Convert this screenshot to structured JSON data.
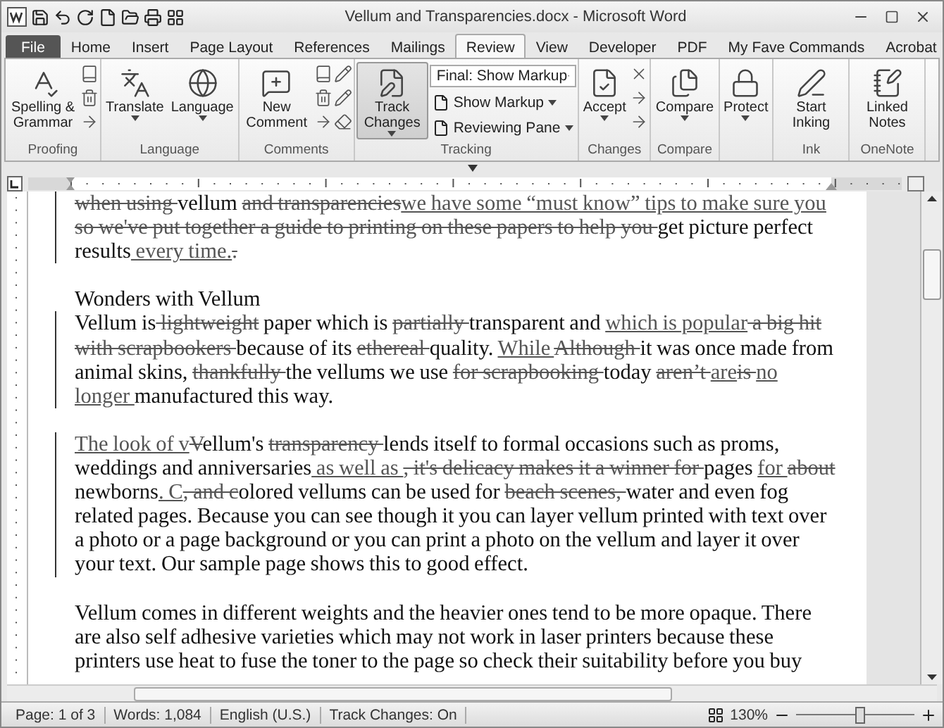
{
  "window": {
    "title": "Vellum and Transparencies.docx - Microsoft Word"
  },
  "tabs": [
    {
      "label": "File",
      "selected": false,
      "kind": "file"
    },
    {
      "label": "Home",
      "selected": false,
      "kind": "tab"
    },
    {
      "label": "Insert",
      "selected": false,
      "kind": "tab"
    },
    {
      "label": "Page Layout",
      "selected": false,
      "kind": "tab"
    },
    {
      "label": "References",
      "selected": false,
      "kind": "tab"
    },
    {
      "label": "Mailings",
      "selected": false,
      "kind": "tab"
    },
    {
      "label": "Review",
      "selected": true,
      "kind": "tab"
    },
    {
      "label": "View",
      "selected": false,
      "kind": "tab"
    },
    {
      "label": "Developer",
      "selected": false,
      "kind": "tab"
    },
    {
      "label": "PDF",
      "selected": false,
      "kind": "tab"
    },
    {
      "label": "My Fave Commands",
      "selected": false,
      "kind": "tab"
    },
    {
      "label": "Acrobat",
      "selected": false,
      "kind": "tab"
    }
  ],
  "ribbon": {
    "groups": [
      {
        "label": "Proofing",
        "buttons": [
          {
            "label": "Spelling & Grammar",
            "kind": "large",
            "menu": false,
            "pressed": false
          },
          {
            "kind": "smalls"
          }
        ]
      },
      {
        "label": "Language",
        "buttons": [
          {
            "label": "Translate",
            "kind": "large",
            "menu": true,
            "pressed": false
          },
          {
            "label": "Language",
            "kind": "large",
            "menu": true,
            "pressed": false
          }
        ]
      },
      {
        "label": "Comments",
        "buttons": [
          {
            "label": "New Comment",
            "kind": "large",
            "menu": false,
            "pressed": false
          },
          {
            "kind": "smalls"
          },
          {
            "kind": "smalls"
          }
        ]
      },
      {
        "label": "Tracking",
        "buttons": [
          {
            "label": "Track Changes",
            "kind": "large",
            "menu": true,
            "pressed": true
          },
          {
            "kind": "list",
            "items": [
              {
                "label": "Final: Show Markup",
                "kind": "dropdown"
              },
              {
                "label": "Show Markup",
                "kind": "menu"
              },
              {
                "label": "Reviewing Pane",
                "kind": "menu"
              }
            ]
          }
        ]
      },
      {
        "label": "Changes",
        "buttons": [
          {
            "label": "Accept",
            "kind": "large",
            "menu": true,
            "pressed": false
          },
          {
            "kind": "smalls"
          }
        ]
      },
      {
        "label": "Compare",
        "buttons": [
          {
            "label": "Compare",
            "kind": "large",
            "menu": true,
            "pressed": false
          }
        ]
      },
      {
        "buttons": [
          {
            "label": "Protect",
            "kind": "large",
            "menu": true,
            "pressed": false
          }
        ]
      },
      {
        "label": "Ink",
        "buttons": [
          {
            "label": "Start Inking",
            "kind": "large",
            "menu": false,
            "pressed": false
          }
        ]
      },
      {
        "label": "OneNote",
        "buttons": [
          {
            "label": "Linked Notes",
            "kind": "large",
            "menu": false,
            "pressed": false
          }
        ]
      }
    ]
  },
  "document": {
    "paragraphs": [
      {
        "kind": "body",
        "changed": true,
        "segments": [
          {
            "kind": "del",
            "text": "when using "
          },
          {
            "kind": "plain",
            "text": "vellum "
          },
          {
            "kind": "del",
            "text": "and transparencies"
          },
          {
            "kind": "ins",
            "text": "we have some “must know” tips to make sure you"
          },
          {
            "kind": "del",
            "text": " so we've put together a guide to printing on these papers to help you "
          },
          {
            "kind": "plain",
            "text": "get picture perfect results"
          },
          {
            "kind": "ins",
            "text": " every time."
          },
          {
            "kind": "del",
            "text": "."
          }
        ]
      },
      {
        "kind": "heading",
        "changed": false,
        "segments": [
          {
            "kind": "plain",
            "text": "Wonders with Vellum"
          }
        ]
      },
      {
        "kind": "body",
        "changed": true,
        "segments": [
          {
            "kind": "plain",
            "text": "Vellum is"
          },
          {
            "kind": "del",
            "text": " lightweight"
          },
          {
            "kind": "plain",
            "text": " paper which is "
          },
          {
            "kind": "del",
            "text": "partially "
          },
          {
            "kind": "plain",
            "text": "transparent and "
          },
          {
            "kind": "ins",
            "text": "which is popular"
          },
          {
            "kind": "del",
            "text": " a big hit with scrapbookers "
          },
          {
            "kind": "plain",
            "text": "because of its "
          },
          {
            "kind": "del",
            "text": "ethereal "
          },
          {
            "kind": "plain",
            "text": "quality. "
          },
          {
            "kind": "ins",
            "text": "While "
          },
          {
            "kind": "del",
            "text": "Although "
          },
          {
            "kind": "plain",
            "text": "it was once made from animal skins, "
          },
          {
            "kind": "del",
            "text": "thankfully "
          },
          {
            "kind": "plain",
            "text": "the vellums we use "
          },
          {
            "kind": "del",
            "text": "for scrapbooking "
          },
          {
            "kind": "plain",
            "text": "today "
          },
          {
            "kind": "del",
            "text": "aren’t "
          },
          {
            "kind": "ins",
            "text": "are"
          },
          {
            "kind": "del",
            "text": "is "
          },
          {
            "kind": "ins",
            "text": " no longer "
          },
          {
            "kind": "plain",
            "text": "manufactured this way."
          }
        ]
      },
      {
        "kind": "body",
        "changed": true,
        "segments": [
          {
            "kind": "ins",
            "text": "The look of v"
          },
          {
            "kind": "del",
            "text": "V"
          },
          {
            "kind": "plain",
            "text": "ellum's "
          },
          {
            "kind": "del",
            "text": "transparency "
          },
          {
            "kind": "plain",
            "text": "lends itself to formal occasions such as proms, weddings and anniversaries"
          },
          {
            "kind": "ins",
            "text": " as well as "
          },
          {
            "kind": "del",
            "text": ", it's delicacy makes it a winner for "
          },
          {
            "kind": "plain",
            "text": "pages "
          },
          {
            "kind": "ins",
            "text": "for "
          },
          {
            "kind": "del",
            "text": "about "
          },
          {
            "kind": "plain",
            "text": "newborns"
          },
          {
            "kind": "ins",
            "text": ". C"
          },
          {
            "kind": "del",
            "text": ", and c"
          },
          {
            "kind": "plain",
            "text": "olored vellums can be used for "
          },
          {
            "kind": "del",
            "text": "beach scenes, "
          },
          {
            "kind": "plain",
            "text": "water and even fog related pages. Because you can see though it you can layer vellum printed with text over a photo or a page background or you can print a photo on the vellum and layer it over your text. Our sample page shows this to good effect."
          }
        ]
      },
      {
        "kind": "body",
        "changed": false,
        "segments": [
          {
            "kind": "plain",
            "text": "Vellum comes in different weights and the heavier ones tend to be more opaque. There are also self adhesive varieties which may not work in laser printers because these printers use heat to fuse the toner to the page so check their suitability before you buy"
          }
        ]
      }
    ]
  },
  "status_bar": {
    "items": [
      "Page: 1 of 3",
      "Words: 1,084",
      "English (U.S.)",
      "Track Changes: On"
    ],
    "zoom": "130%",
    "zoom_slider": {
      "level": 0.55
    }
  }
}
